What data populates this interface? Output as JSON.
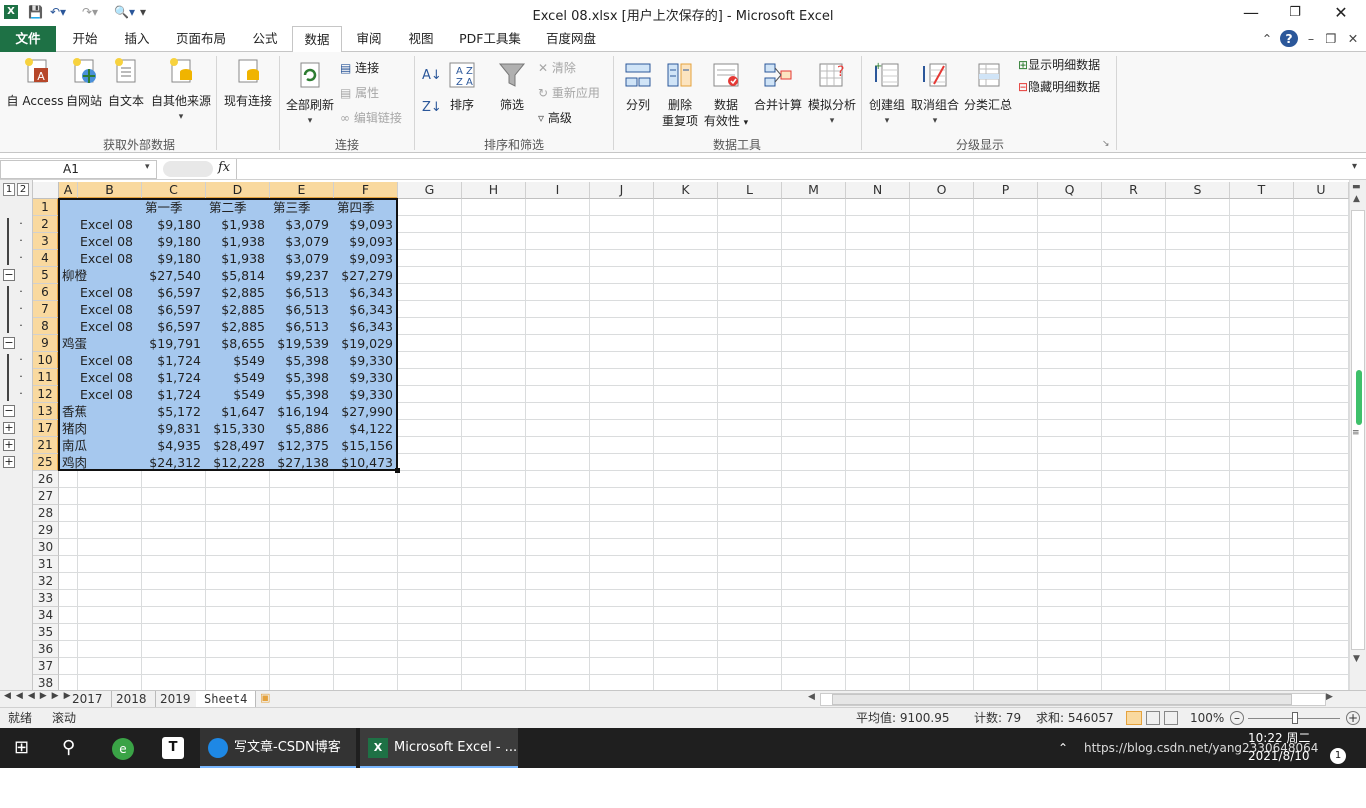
{
  "window": {
    "title": "Excel 08.xlsx [用户上次保存的]  -  Microsoft Excel"
  },
  "tabs": [
    "文件",
    "开始",
    "插入",
    "页面布局",
    "公式",
    "数据",
    "审阅",
    "视图",
    "PDF工具集",
    "百度网盘"
  ],
  "ribbon": {
    "get_external": {
      "name": "获取外部数据",
      "access": "自 Access",
      "web": "自网站",
      "text": "自文本",
      "other": "自其他来源",
      "existing": "现有连接"
    },
    "connections": {
      "name": "连接",
      "refresh_all": "全部刷新",
      "connections": "连接",
      "properties": "属性",
      "edit_links": "编辑链接"
    },
    "sort_filter": {
      "name": "排序和筛选",
      "sort": "排序",
      "filter": "筛选",
      "clear": "清除",
      "reapply": "重新应用",
      "advanced": "高级"
    },
    "data_tools": {
      "name": "数据工具",
      "text_to_columns": "分列",
      "remove_dup_1": "删除",
      "remove_dup_2": "重复项",
      "validation_1": "数据",
      "validation_2": "有效性",
      "consolidate": "合并计算",
      "what_if": "模拟分析"
    },
    "outline": {
      "name": "分级显示",
      "group": "创建组",
      "ungroup": "取消组合",
      "subtotal": "分类汇总",
      "show_detail": "显示明细数据",
      "hide_detail": "隐藏明细数据"
    }
  },
  "formula_bar": {
    "name_box": "A1",
    "fx": "fx",
    "value": ""
  },
  "outline_levels": [
    "1",
    "2"
  ],
  "columns": [
    "A",
    "B",
    "C",
    "D",
    "E",
    "F",
    "G",
    "H",
    "I",
    "J",
    "K",
    "L",
    "M",
    "N",
    "O",
    "P",
    "Q",
    "R",
    "S",
    "T",
    "U"
  ],
  "rows": [
    {
      "num": "1",
      "a": "",
      "b": "",
      "c": "第一季",
      "d": "第二季",
      "e": "第三季",
      "f": "第四季",
      "hdr": true
    },
    {
      "num": "2",
      "a": "",
      "b": "Excel 08",
      "c": "$9,180",
      "d": "$1,938",
      "e": "$3,079",
      "f": "$9,093"
    },
    {
      "num": "3",
      "a": "",
      "b": "Excel 08",
      "c": "$9,180",
      "d": "$1,938",
      "e": "$3,079",
      "f": "$9,093"
    },
    {
      "num": "4",
      "a": "",
      "b": "Excel 08",
      "c": "$9,180",
      "d": "$1,938",
      "e": "$3,079",
      "f": "$9,093"
    },
    {
      "num": "5",
      "a": "柳橙",
      "b": "",
      "c": "$27,540",
      "d": "$5,814",
      "e": "$9,237",
      "f": "$27,279"
    },
    {
      "num": "6",
      "a": "",
      "b": "Excel 08",
      "c": "$6,597",
      "d": "$2,885",
      "e": "$6,513",
      "f": "$6,343"
    },
    {
      "num": "7",
      "a": "",
      "b": "Excel 08",
      "c": "$6,597",
      "d": "$2,885",
      "e": "$6,513",
      "f": "$6,343"
    },
    {
      "num": "8",
      "a": "",
      "b": "Excel 08",
      "c": "$6,597",
      "d": "$2,885",
      "e": "$6,513",
      "f": "$6,343"
    },
    {
      "num": "9",
      "a": "鸡蛋",
      "b": "",
      "c": "$19,791",
      "d": "$8,655",
      "e": "$19,539",
      "f": "$19,029"
    },
    {
      "num": "10",
      "a": "",
      "b": "Excel 08",
      "c": "$1,724",
      "d": "$549",
      "e": "$5,398",
      "f": "$9,330"
    },
    {
      "num": "11",
      "a": "",
      "b": "Excel 08",
      "c": "$1,724",
      "d": "$549",
      "e": "$5,398",
      "f": "$9,330"
    },
    {
      "num": "12",
      "a": "",
      "b": "Excel 08",
      "c": "$1,724",
      "d": "$549",
      "e": "$5,398",
      "f": "$9,330"
    },
    {
      "num": "13",
      "a": "香蕉",
      "b": "",
      "c": "$5,172",
      "d": "$1,647",
      "e": "$16,194",
      "f": "$27,990"
    },
    {
      "num": "17",
      "a": "猪肉",
      "b": "",
      "c": "$9,831",
      "d": "$15,330",
      "e": "$5,886",
      "f": "$4,122"
    },
    {
      "num": "21",
      "a": "南瓜",
      "b": "",
      "c": "$4,935",
      "d": "$28,497",
      "e": "$12,375",
      "f": "$15,156"
    },
    {
      "num": "25",
      "a": "鸡肉",
      "b": "",
      "c": "$24,312",
      "d": "$12,228",
      "e": "$27,138",
      "f": "$10,473"
    }
  ],
  "empty_rows": [
    "26",
    "27",
    "28",
    "29",
    "30",
    "31",
    "32",
    "33",
    "34",
    "35",
    "36",
    "37",
    "38"
  ],
  "sheet_tabs": [
    "2017",
    "2018",
    "2019",
    "Sheet4"
  ],
  "active_sheet": "Sheet4",
  "status": {
    "ready": "就绪",
    "scroll": "滚动",
    "average": "平均值: 9100.95",
    "count": "计数: 79",
    "sum": "求和: 546057",
    "zoom": "100%"
  },
  "taskbar": {
    "apps": [
      "写文章-CSDN博客 ...",
      "Microsoft Excel - ..."
    ],
    "time": "10:22 周二",
    "date": "2021/8/10",
    "tray_text": "https://blog.csdn.net/yang2330648064"
  }
}
